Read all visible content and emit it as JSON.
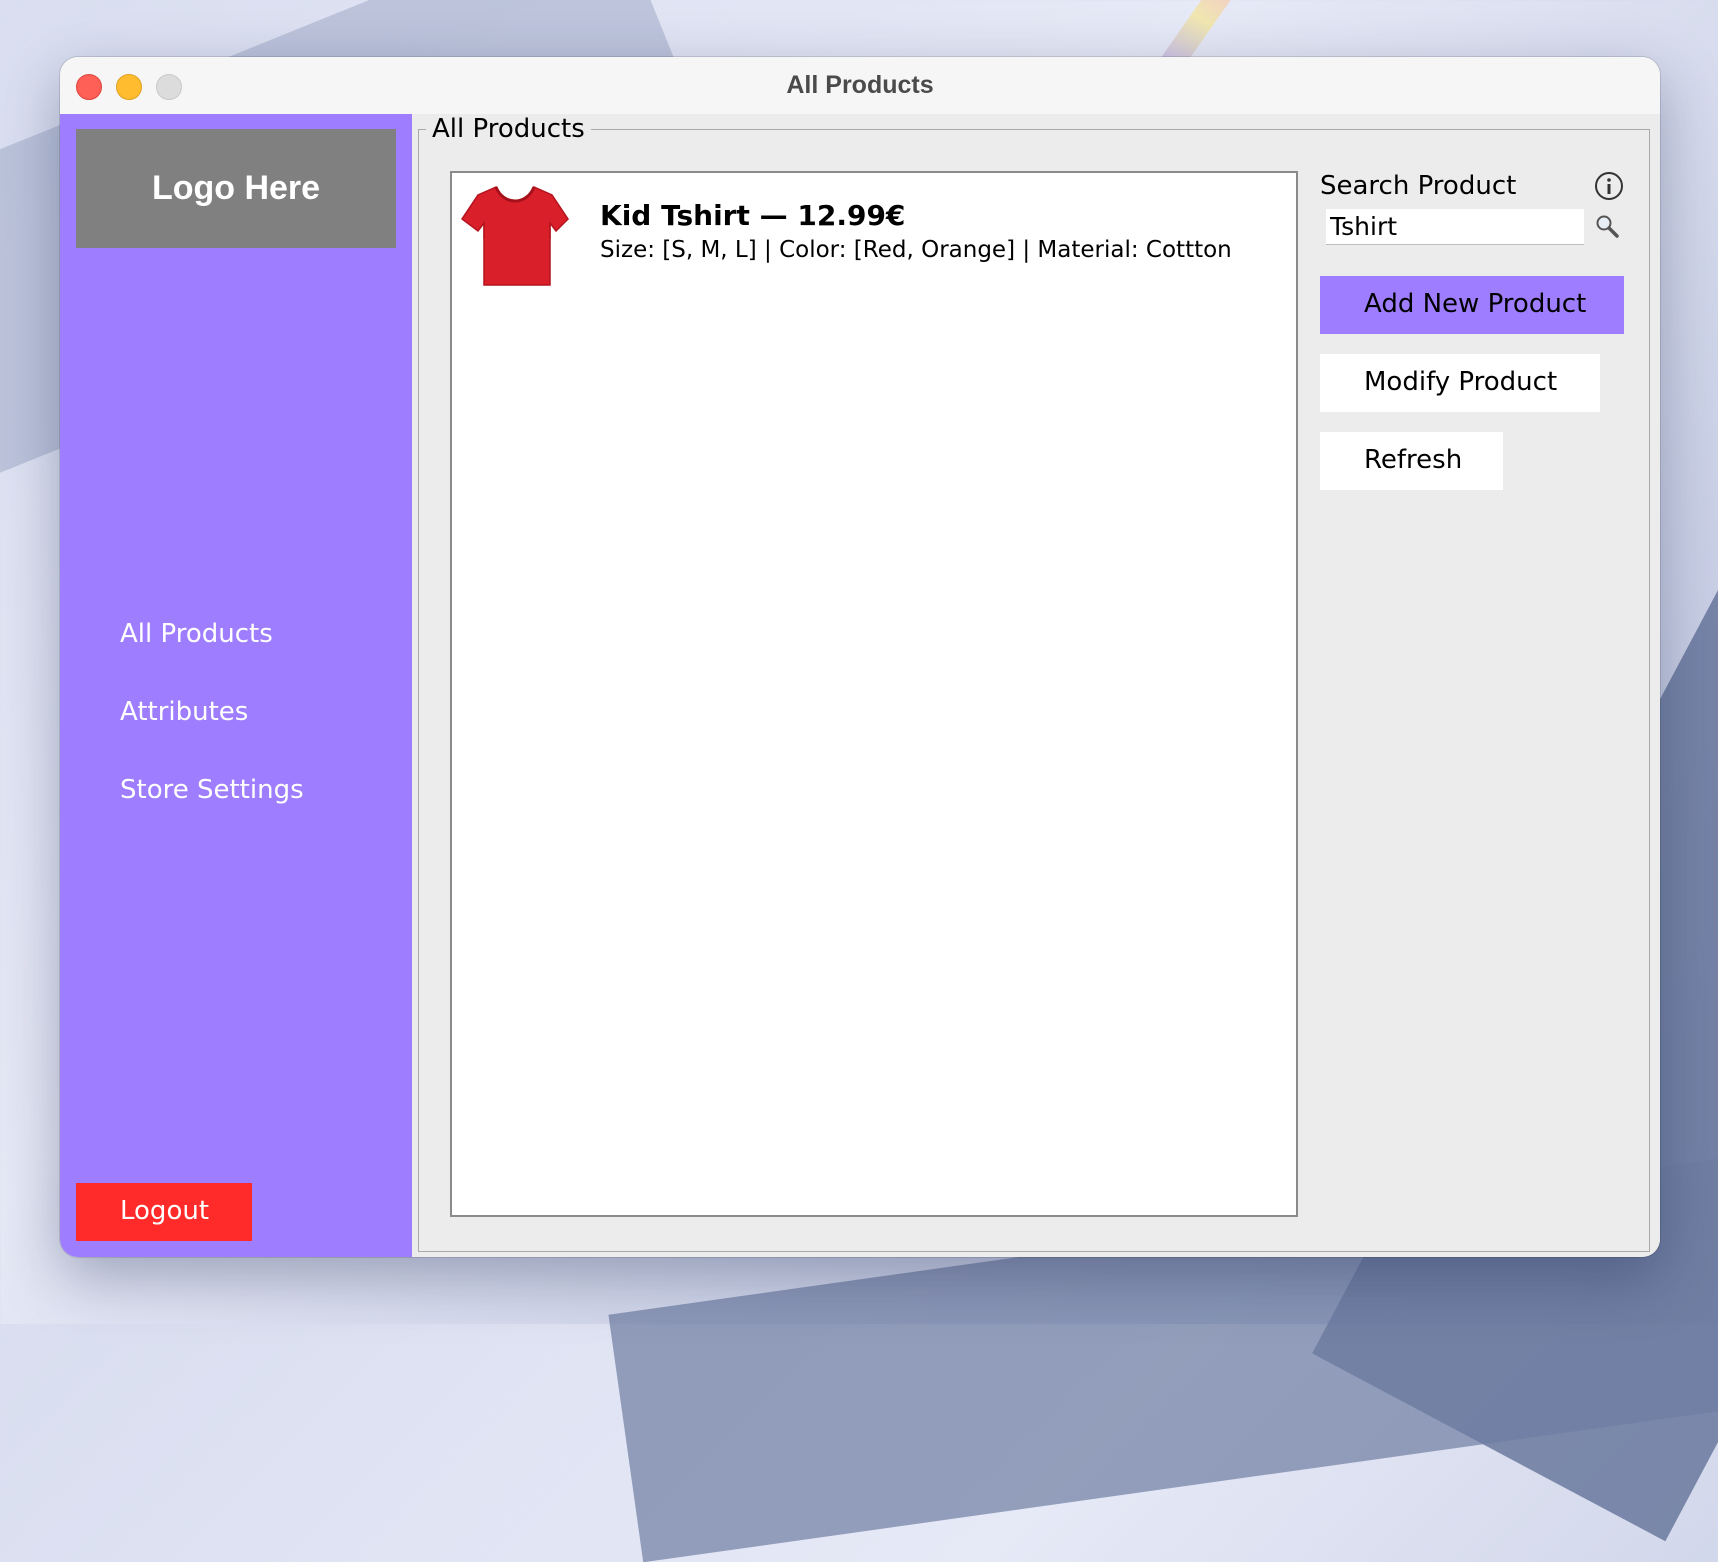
{
  "window": {
    "title": "All Products"
  },
  "sidebar": {
    "logo_text": "Logo Here",
    "items": [
      {
        "label": "All Products"
      },
      {
        "label": "Attributes"
      },
      {
        "label": "Store Settings"
      }
    ],
    "logout_label": "Logout"
  },
  "main": {
    "group_label": "All Products",
    "products": [
      {
        "name_price": "Kid Tshirt — 12.99€",
        "details": "Size: [S, M, L] | Color: [Red, Orange] | Material: Cottton",
        "image_icon": "red-tshirt"
      }
    ]
  },
  "right_panel": {
    "search_label": "Search Product",
    "search_value": "Tshirt",
    "add_label": "Add New Product",
    "modify_label": "Modify Product",
    "refresh_label": "Refresh"
  },
  "colors": {
    "sidebar": "#9e7efe",
    "add_button": "#9e7efe",
    "logout_button": "#ff2b2b",
    "logo_box": "#808080"
  }
}
